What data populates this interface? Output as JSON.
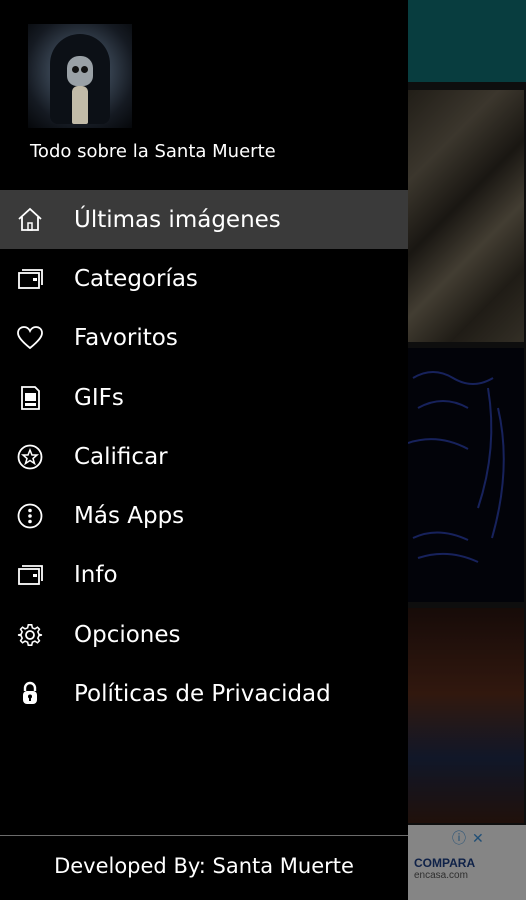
{
  "drawer": {
    "app_name": "Todo sobre la Santa Muerte",
    "items": [
      {
        "label": "Últimas imágenes",
        "icon": "home-icon",
        "active": true
      },
      {
        "label": "Categorías",
        "icon": "folders-icon",
        "active": false
      },
      {
        "label": "Favoritos",
        "icon": "heart-icon",
        "active": false
      },
      {
        "label": "GIFs",
        "icon": "gif-file-icon",
        "active": false
      },
      {
        "label": "Calificar",
        "icon": "star-circle-icon",
        "active": false
      },
      {
        "label": "Más Apps",
        "icon": "more-circle-icon",
        "active": false
      },
      {
        "label": "Info",
        "icon": "folders-icon",
        "active": false
      },
      {
        "label": "Opciones",
        "icon": "gear-icon",
        "active": false
      },
      {
        "label": "Políticas de Privacidad",
        "icon": "lock-icon",
        "active": false
      }
    ],
    "footer": "Developed By: Santa Muerte"
  },
  "background": {
    "ad_brand": "COMPARA",
    "ad_sub": "encasa.com"
  },
  "colors": {
    "toolbar": "#0f6f73",
    "drawer_bg": "#000000",
    "active_item_bg": "#3a3a3a"
  }
}
